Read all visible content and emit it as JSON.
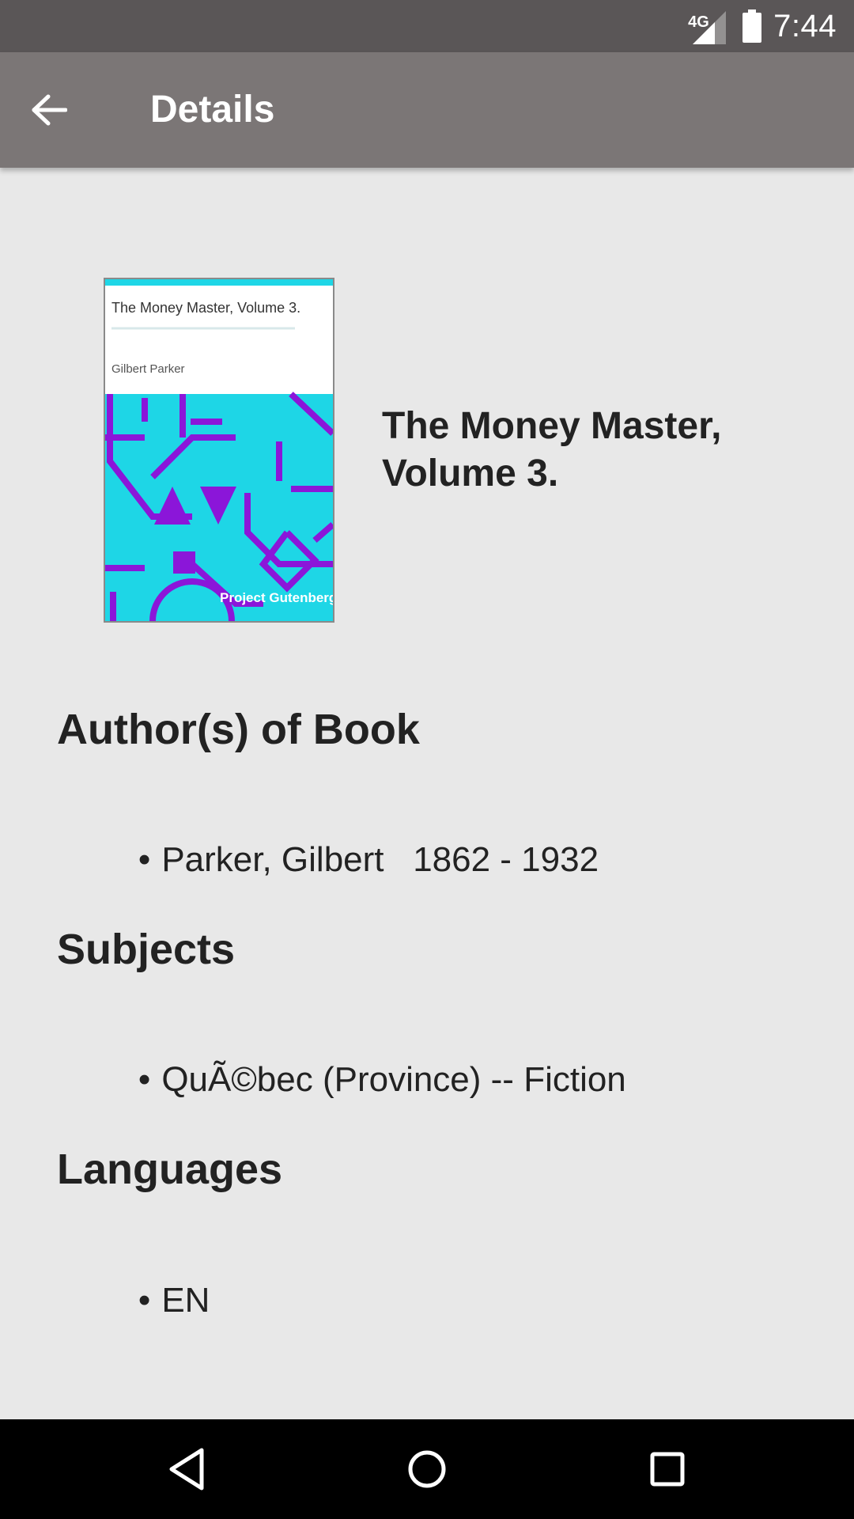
{
  "status_bar": {
    "network_label": "4G",
    "time": "7:44",
    "icons": [
      "signal-icon",
      "battery-icon"
    ]
  },
  "app_bar": {
    "back_icon": "arrow-back-icon",
    "title": "Details"
  },
  "book": {
    "title": "The Money Master, Volume 3.",
    "cover": {
      "title": "The Money Master, Volume 3.",
      "author": "Gilbert Parker",
      "publisher": "Project Gutenberg",
      "colors": {
        "background": "#1ed6e6",
        "shapes": "#8b16d9",
        "header": "#ffffff"
      }
    }
  },
  "sections": {
    "authors": {
      "heading": "Author(s) of Book",
      "items": [
        "Parker, Gilbert   1862 - 1932"
      ]
    },
    "subjects": {
      "heading": "Subjects",
      "items": [
        "QuÃ©bec (Province) -- Fiction"
      ]
    },
    "languages": {
      "heading": "Languages",
      "items": [
        "EN"
      ]
    }
  },
  "bullet": "•",
  "nav_bar": {
    "icons": [
      "back-triangle-icon",
      "home-circle-icon",
      "recents-square-icon"
    ]
  },
  "colors": {
    "status_bar": "#5a5657",
    "app_bar": "#7b7676",
    "background": "#e8e8e8",
    "text": "#222222",
    "nav_bar": "#000000"
  }
}
